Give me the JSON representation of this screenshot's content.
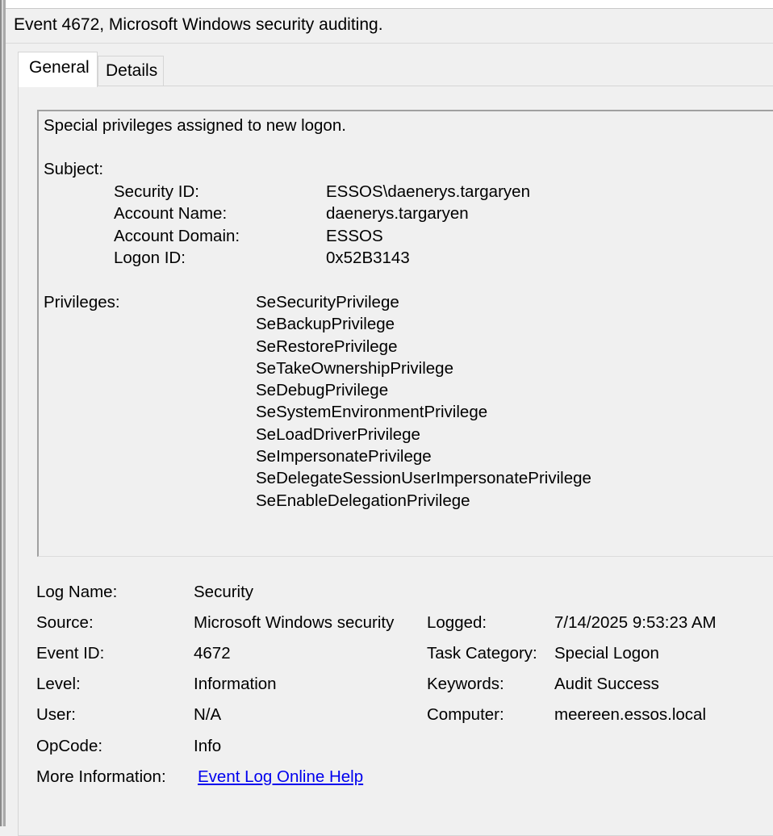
{
  "window": {
    "title": "Event 4672, Microsoft Windows security auditing."
  },
  "tabs": [
    {
      "label": "General",
      "selected": true
    },
    {
      "label": "Details",
      "selected": false
    }
  ],
  "description": {
    "summary": "Special privileges assigned to new logon.",
    "subject_heading": "Subject:",
    "subject_fields": [
      {
        "label": "Security ID:",
        "value": "ESSOS\\daenerys.targaryen"
      },
      {
        "label": "Account Name:",
        "value": "daenerys.targaryen"
      },
      {
        "label": "Account Domain:",
        "value": "ESSOS"
      },
      {
        "label": "Logon ID:",
        "value": "0x52B3143"
      }
    ],
    "privileges_heading": "Privileges:",
    "privileges": [
      "SeSecurityPrivilege",
      "SeBackupPrivilege",
      "SeRestorePrivilege",
      "SeTakeOwnershipPrivilege",
      "SeDebugPrivilege",
      "SeSystemEnvironmentPrivilege",
      "SeLoadDriverPrivilege",
      "SeImpersonatePrivilege",
      "SeDelegateSessionUserImpersonatePrivilege",
      "SeEnableDelegationPrivilege"
    ]
  },
  "details": {
    "log_name": {
      "label": "Log Name:",
      "value": "Security"
    },
    "source": {
      "label": "Source:",
      "value": "Microsoft Windows security"
    },
    "logged": {
      "label": "Logged:",
      "value": "7/14/2025 9:53:23 AM"
    },
    "event_id": {
      "label": "Event ID:",
      "value": "4672"
    },
    "task_category": {
      "label": "Task Category:",
      "value": "Special Logon"
    },
    "level": {
      "label": "Level:",
      "value": "Information"
    },
    "keywords": {
      "label": "Keywords:",
      "value": "Audit Success"
    },
    "user": {
      "label": "User:",
      "value": "N/A"
    },
    "computer": {
      "label": "Computer:",
      "value": "meereen.essos.local"
    },
    "opcode": {
      "label": "OpCode:",
      "value": "Info"
    },
    "more_information": {
      "label": "More Information:",
      "link_text": "Event Log Online Help"
    }
  },
  "colors": {
    "background": "#f0f0f0",
    "link": "#0000ee",
    "border": "#a0a0a0"
  }
}
